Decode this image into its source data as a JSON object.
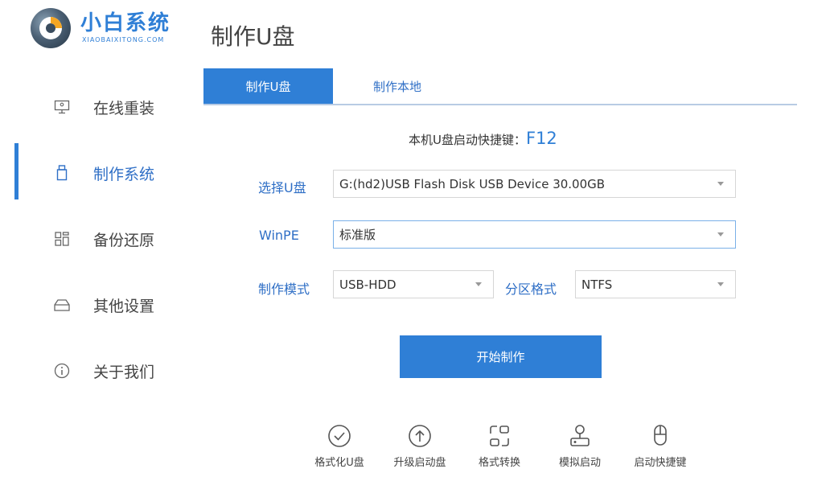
{
  "app": {
    "name": "小白系统",
    "subtitle": "XIAOBAIXITONG.COM",
    "logo_icon": "logo-icon",
    "brand_color": "#2f7fd6"
  },
  "page_title": "制作U盘",
  "sidebar": {
    "items": [
      {
        "label": "在线重装",
        "icon": "monitor-icon",
        "active": false
      },
      {
        "label": "制作系统",
        "icon": "usb-icon",
        "active": true
      },
      {
        "label": "备份还原",
        "icon": "grid-icon",
        "active": false
      },
      {
        "label": "其他设置",
        "icon": "tray-icon",
        "active": false
      },
      {
        "label": "关于我们",
        "icon": "info-icon",
        "active": false
      }
    ]
  },
  "tabs": [
    {
      "label": "制作U盘",
      "active": true
    },
    {
      "label": "制作本地",
      "active": false
    }
  ],
  "hotkey": {
    "label": "本机U盘启动快捷键：",
    "key": "F12"
  },
  "form": {
    "usb_label": "选择U盘",
    "usb_value": "G:(hd2)USB Flash Disk USB Device 30.00GB",
    "winpe_label": "WinPE",
    "winpe_value": "标准版",
    "mode_label": "制作模式",
    "mode_value": "USB-HDD",
    "partition_label": "分区格式",
    "partition_value": "NTFS"
  },
  "start_button": "开始制作",
  "tools": [
    {
      "label": "格式化U盘",
      "icon": "check-circle-icon"
    },
    {
      "label": "升级启动盘",
      "icon": "upload-circle-icon"
    },
    {
      "label": "格式转换",
      "icon": "convert-icon"
    },
    {
      "label": "模拟启动",
      "icon": "simulate-icon"
    },
    {
      "label": "启动快捷键",
      "icon": "mouse-icon"
    }
  ]
}
